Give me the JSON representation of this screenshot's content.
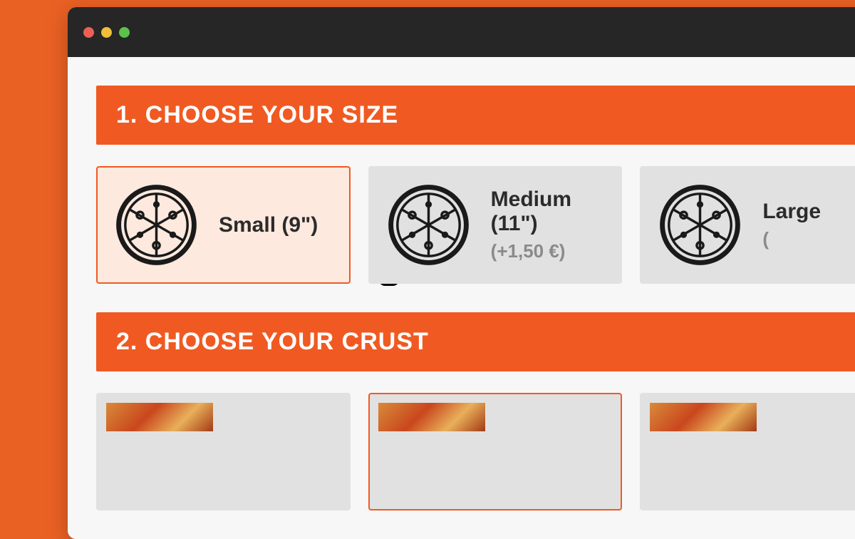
{
  "sections": {
    "size": {
      "header": "1. CHOOSE YOUR SIZE",
      "options": [
        {
          "label": "Small (9\")",
          "price": "",
          "selected": true
        },
        {
          "label": "Medium (11\")",
          "price": "(+1,50 €)",
          "selected": false
        },
        {
          "label": "Large",
          "price": "(",
          "selected": false
        }
      ]
    },
    "crust": {
      "header": "2. CHOOSE YOUR CRUST",
      "options": [
        {
          "selected": false
        },
        {
          "selected": true
        },
        {
          "selected": false
        }
      ]
    }
  },
  "colors": {
    "accent": "#f05a22",
    "page_bg": "#ea6124",
    "card_bg": "#e1e1e1",
    "selected_bg": "#fde9de"
  }
}
